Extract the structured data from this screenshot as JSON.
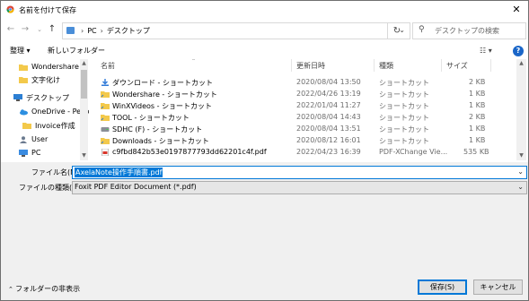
{
  "window": {
    "title": "名前を付けて保存",
    "close": "✕"
  },
  "address": {
    "crumbs": [
      "PC",
      "デスクトップ"
    ],
    "search_placeholder": "デスクトップの検索"
  },
  "toolbar": {
    "organize": "整理 ▾",
    "new_folder": "新しいフォルダー",
    "view": "☷ ▾",
    "help": "?"
  },
  "nav": {
    "items": [
      {
        "label": "Wondershare",
        "icon": "folder-icon"
      },
      {
        "label": "文字化け",
        "icon": "folder-icon"
      },
      {
        "label": "デスクトップ",
        "icon": "desktop-icon"
      },
      {
        "label": "OneDrive - Perso",
        "icon": "cloud-icon"
      },
      {
        "label": "Invoice作成",
        "icon": "folder-icon"
      },
      {
        "label": "User",
        "icon": "user-icon"
      },
      {
        "label": "PC",
        "icon": "pc-icon"
      }
    ]
  },
  "list": {
    "columns": [
      "名前",
      "更新日時",
      "種類",
      "サイズ"
    ],
    "rows": [
      {
        "name": "ダウンロード - ショートカット",
        "date": "2020/08/04 13:50",
        "type": "ショートカット",
        "size": "2 KB",
        "icon": "shortcut-download-icon"
      },
      {
        "name": "Wondershare - ショートカット",
        "date": "2022/04/26 13:19",
        "type": "ショートカット",
        "size": "1 KB",
        "icon": "shortcut-folder-icon"
      },
      {
        "name": "WinXVideos - ショートカット",
        "date": "2022/01/04 11:27",
        "type": "ショートカット",
        "size": "1 KB",
        "icon": "shortcut-folder-icon"
      },
      {
        "name": "TOOL - ショートカット",
        "date": "2020/08/04 14:43",
        "type": "ショートカット",
        "size": "2 KB",
        "icon": "shortcut-folder-icon"
      },
      {
        "name": "SDHC (F) - ショートカット",
        "date": "2020/08/04 13:51",
        "type": "ショートカット",
        "size": "1 KB",
        "icon": "shortcut-drive-icon"
      },
      {
        "name": "Downloads - ショートカット",
        "date": "2020/08/12 16:01",
        "type": "ショートカット",
        "size": "1 KB",
        "icon": "shortcut-folder-icon"
      },
      {
        "name": "c9fbd842b53e0197877793dd62201c4f.pdf",
        "date": "2022/04/23 16:39",
        "type": "PDF-XChange Vie...",
        "size": "535 KB",
        "icon": "pdf-icon"
      }
    ]
  },
  "save_form": {
    "filename_label": "ファイル名(N):",
    "filename_value": "AxelaNote操作手順書.pdf",
    "filetype_label": "ファイルの種類(T):",
    "filetype_value": "Foxit PDF Editor Document (*.pdf)"
  },
  "footer": {
    "hide_folders": "フォルダーの非表示",
    "save": "保存(S)",
    "cancel": "キャンセル"
  },
  "colors": {
    "accent": "#0078d7",
    "folder": "#f3c94b",
    "footer_bg": "#f0f0f0"
  }
}
